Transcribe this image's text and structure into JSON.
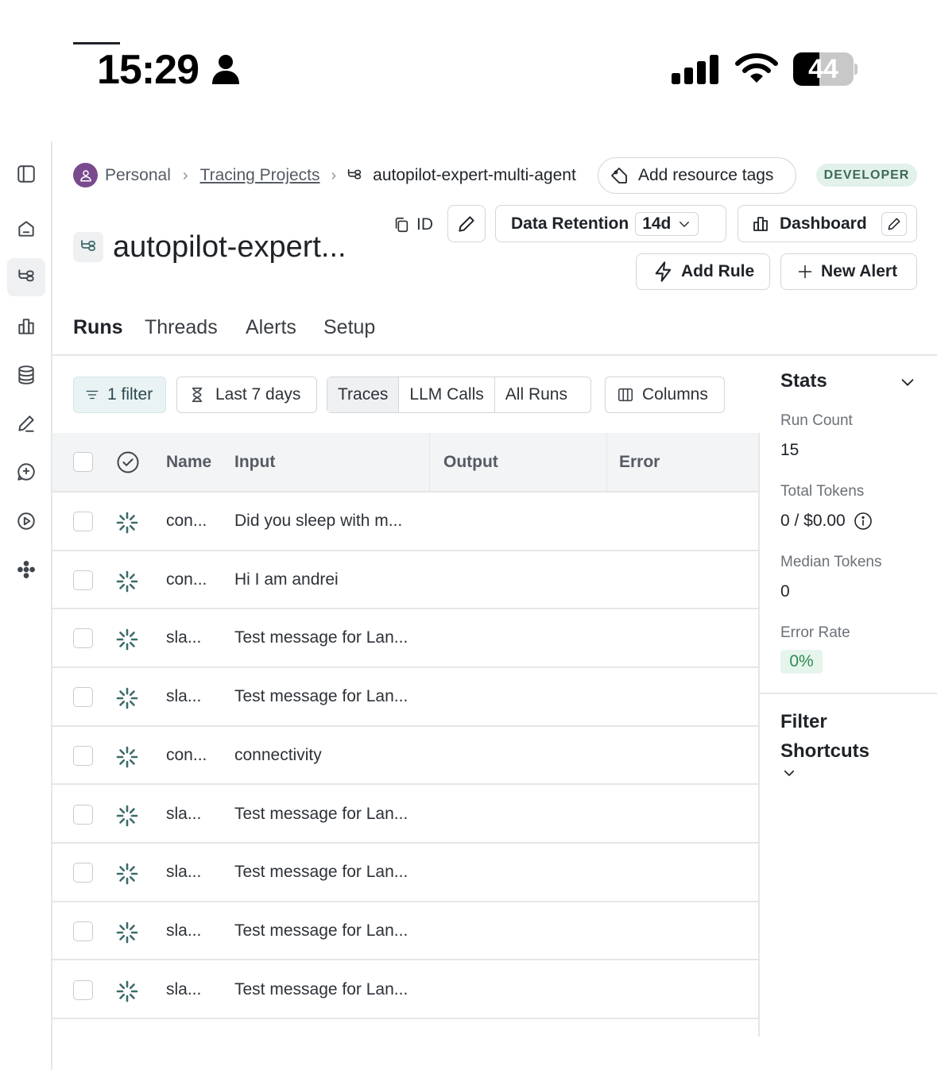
{
  "status_bar": {
    "time": "15:29",
    "battery": "44",
    "battery_level": 0.44
  },
  "breadcrumb": {
    "workspace": "Personal",
    "section": "Tracing Projects",
    "project": "autopilot-expert-multi-agent"
  },
  "header": {
    "tags_button": "Add resource tags",
    "badge": "DEVELOPER",
    "title": "autopilot-expert...",
    "id_label": "ID",
    "retention_label": "Data Retention",
    "retention_value": "14d",
    "dashboard_label": "Dashboard",
    "add_rule_label": "Add Rule",
    "new_alert_label": "New Alert"
  },
  "tabs": [
    "Runs",
    "Threads",
    "Alerts",
    "Setup"
  ],
  "active_tab": "Runs",
  "toolbar": {
    "filter_label": "1 filter",
    "date_label": "Last 7 days",
    "segments": [
      "Traces",
      "LLM Calls",
      "All Runs"
    ],
    "active_segment": "Traces",
    "columns_label": "Columns"
  },
  "table": {
    "columns": [
      "Name",
      "Input",
      "Output",
      "Error"
    ],
    "rows": [
      {
        "name": "con...",
        "input": "Did you sleep with m..."
      },
      {
        "name": "con...",
        "input": "Hi I am andrei"
      },
      {
        "name": "sla...",
        "input": "Test message for Lan..."
      },
      {
        "name": "sla...",
        "input": "Test message for Lan..."
      },
      {
        "name": "con...",
        "input": "connectivity"
      },
      {
        "name": "sla...",
        "input": "Test message for Lan..."
      },
      {
        "name": "sla...",
        "input": "Test message for Lan..."
      },
      {
        "name": "sla...",
        "input": "Test message for Lan..."
      },
      {
        "name": "sla...",
        "input": "Test message for Lan..."
      }
    ]
  },
  "stats": {
    "title": "Stats",
    "run_count_label": "Run Count",
    "run_count": "15",
    "total_tokens_label": "Total Tokens",
    "total_tokens": "0 / $0.00",
    "median_tokens_label": "Median Tokens",
    "median_tokens": "0",
    "error_rate_label": "Error Rate",
    "error_rate": "0%"
  },
  "filter_shortcuts": {
    "title": "Filter Shortcuts"
  }
}
